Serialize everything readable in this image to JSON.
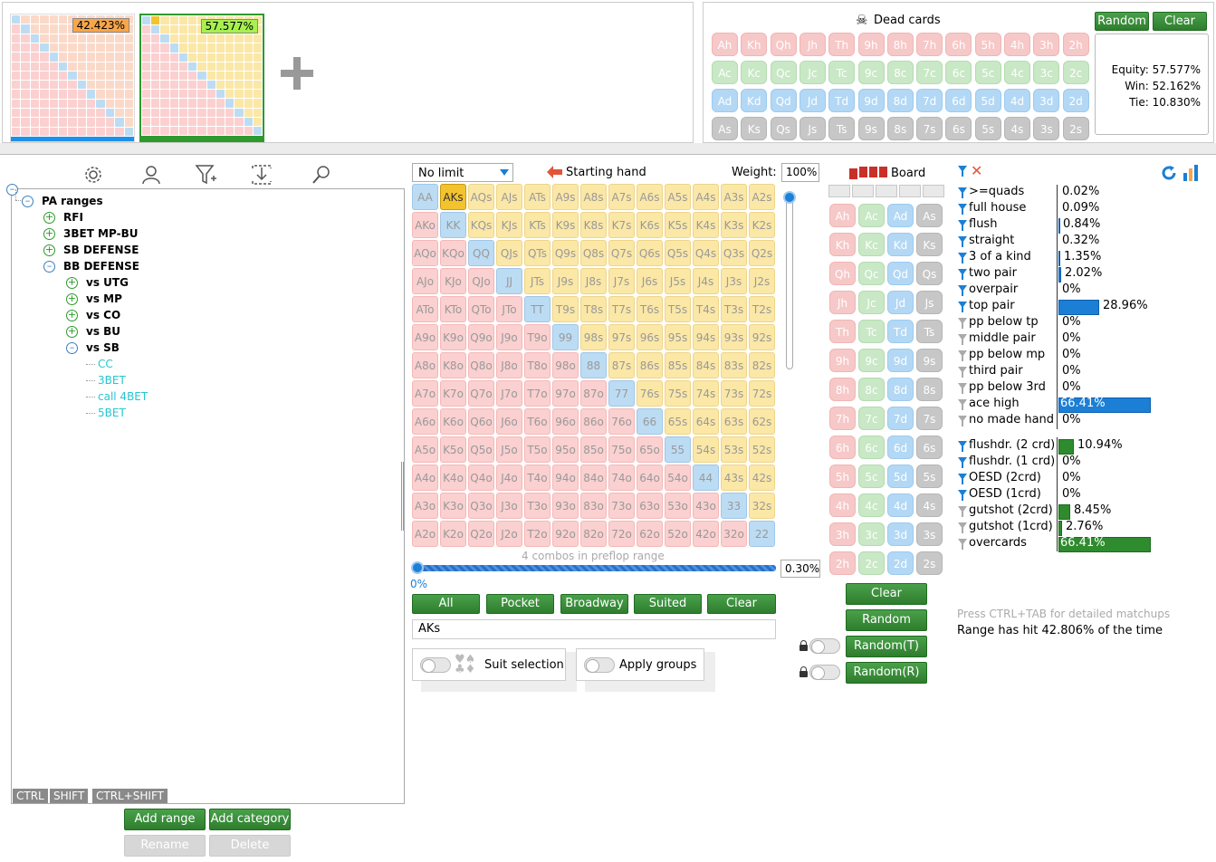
{
  "top": {
    "range1_pct": "42.423%",
    "range2_pct": "57.577%",
    "dead_cards_label": "Dead cards",
    "random_label": "Random",
    "clear_label": "Clear",
    "equity": "Equity: 57.577%",
    "win": "Win: 52.162%",
    "tie": "Tie: 10.830%"
  },
  "ranks": [
    "A",
    "K",
    "Q",
    "J",
    "T",
    "9",
    "8",
    "7",
    "6",
    "5",
    "4",
    "3",
    "2"
  ],
  "suits": [
    "h",
    "c",
    "d",
    "s"
  ],
  "tree": {
    "root": "PA ranges",
    "items": [
      {
        "label": "RFI"
      },
      {
        "label": "3BET MP-BU"
      },
      {
        "label": "SB DEFENSE"
      },
      {
        "label": "BB DEFENSE"
      },
      {
        "label": "vs UTG"
      },
      {
        "label": "vs MP"
      },
      {
        "label": "vs CO"
      },
      {
        "label": "vs BU"
      },
      {
        "label": "vs SB"
      },
      {
        "label": "CC"
      },
      {
        "label": "3BET"
      },
      {
        "label": "call 4BET"
      },
      {
        "label": "5BET"
      }
    ],
    "tabs": [
      "CTRL",
      "SHIFT",
      "CTRL+SHIFT"
    ],
    "add_range": "Add range",
    "add_category": "Add category",
    "rename": "Rename",
    "delete": "Delete"
  },
  "matrix": {
    "game": "No limit",
    "starting_hand": "Starting hand",
    "weight_label": "Weight:",
    "weight_value": "100%",
    "combos_text": "4 combos in preflop range",
    "slider_pct": "0%",
    "slider_value": "0.30%",
    "buttons": [
      "All",
      "Pocket",
      "Broadway",
      "Suited",
      "Clear"
    ],
    "selected_input": "AKs",
    "suit_selection": "Suit selection",
    "apply_groups": "Apply groups"
  },
  "board": {
    "label": "Board",
    "clear": "Clear",
    "random": "Random",
    "random_t": "Random(T)",
    "random_r": "Random(R)"
  },
  "stats": {
    "made": [
      {
        "label": ">=quads",
        "value": "0.02%",
        "pct": 0.02,
        "active": true
      },
      {
        "label": "full house",
        "value": "0.09%",
        "pct": 0.09,
        "active": true
      },
      {
        "label": "flush",
        "value": "0.84%",
        "pct": 0.84,
        "active": true
      },
      {
        "label": "straight",
        "value": "0.32%",
        "pct": 0.32,
        "active": true
      },
      {
        "label": "3 of a kind",
        "value": "1.35%",
        "pct": 1.35,
        "active": true
      },
      {
        "label": "two pair",
        "value": "2.02%",
        "pct": 2.02,
        "active": true
      },
      {
        "label": "overpair",
        "value": "0%",
        "pct": 0,
        "active": true
      },
      {
        "label": "top pair",
        "value": "28.96%",
        "pct": 28.96,
        "active": true
      },
      {
        "label": "pp below tp",
        "value": "0%",
        "pct": 0,
        "active": false
      },
      {
        "label": "middle pair",
        "value": "0%",
        "pct": 0,
        "active": false
      },
      {
        "label": "pp below mp",
        "value": "0%",
        "pct": 0,
        "active": false
      },
      {
        "label": "third pair",
        "value": "0%",
        "pct": 0,
        "active": false
      },
      {
        "label": "pp below 3rd",
        "value": "0%",
        "pct": 0,
        "active": false
      },
      {
        "label": "ace high",
        "value": "66.41%",
        "pct": 66.41,
        "active": false
      },
      {
        "label": "no made hand",
        "value": "0%",
        "pct": 0,
        "active": false
      }
    ],
    "draws": [
      {
        "label": "flushdr. (2 crd)",
        "value": "10.94%",
        "pct": 10.94,
        "active": true
      },
      {
        "label": "flushdr. (1 crd)",
        "value": "0%",
        "pct": 0,
        "active": true
      },
      {
        "label": "OESD (2crd)",
        "value": "0%",
        "pct": 0,
        "active": true
      },
      {
        "label": "OESD (1crd)",
        "value": "0%",
        "pct": 0,
        "active": true
      },
      {
        "label": "gutshot (2crd)",
        "value": "8.45%",
        "pct": 8.45,
        "active": false
      },
      {
        "label": "gutshot (1crd)",
        "value": "2.76%",
        "pct": 2.76,
        "active": false
      },
      {
        "label": "overcards",
        "value": "66.41%",
        "pct": 66.41,
        "active": false
      }
    ],
    "hint": "Press CTRL+TAB for detailed matchups",
    "hit": "Range has hit 42.806% of the time"
  },
  "colors": {
    "accent_blue": "#1b7fd6",
    "green": "#2e8b2e",
    "orange": "#f7a64a",
    "lime": "#a7f04f"
  }
}
